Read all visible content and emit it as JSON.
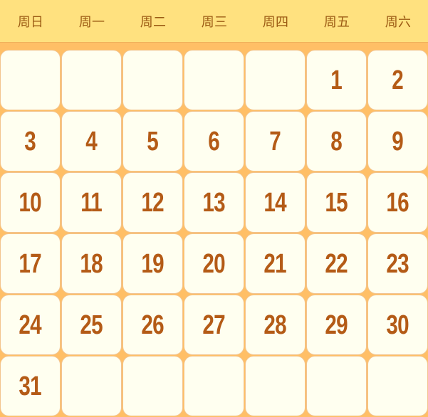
{
  "header": {
    "weekdays": [
      "周日",
      "周一",
      "周二",
      "周三",
      "周四",
      "周五",
      "周六"
    ]
  },
  "calendar": {
    "rows": [
      [
        "",
        "",
        "",
        "",
        "",
        "1",
        "2"
      ],
      [
        "3",
        "4",
        "5",
        "6",
        "7",
        "8",
        "9"
      ],
      [
        "10",
        "11",
        "12",
        "13",
        "14",
        "15",
        "16"
      ],
      [
        "17",
        "18",
        "19",
        "20",
        "21",
        "22",
        "23"
      ],
      [
        "24",
        "25",
        "26",
        "27",
        "28",
        "29",
        "30"
      ],
      [
        "31",
        "",
        "",
        "",
        "",
        "",
        ""
      ]
    ]
  },
  "colors": {
    "background": "#ffbf66",
    "header_bg": "#ffe17f",
    "cell_bg": "#fffff0",
    "number": "#b45b16",
    "weekday_text": "#9b5a13"
  }
}
